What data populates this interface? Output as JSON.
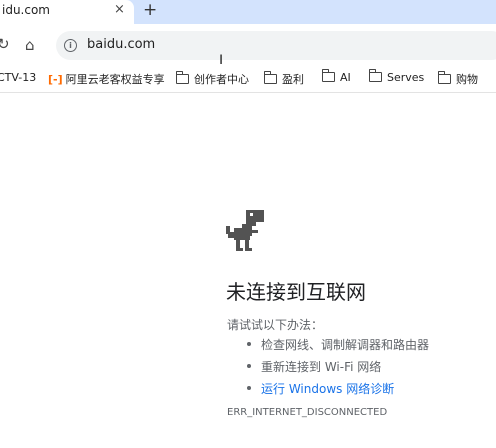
{
  "tab": {
    "title": "idu.com",
    "close": "×",
    "new_tab": "+"
  },
  "toolbar": {
    "reload": "↻",
    "home": "⌂",
    "info": "i",
    "url": "baidu.com",
    "cursor": "I"
  },
  "bookmarks": [
    {
      "label": "CTV-13",
      "icon": "none"
    },
    {
      "label": "阿里云老客权益专享",
      "icon": "aliyun-icon"
    },
    {
      "label": "创作者中心",
      "icon": "folder-icon"
    },
    {
      "label": "盈利",
      "icon": "folder-icon"
    },
    {
      "label": "AI",
      "icon": "folder-icon"
    },
    {
      "label": "Serves",
      "icon": "folder-icon"
    },
    {
      "label": "购物",
      "icon": "folder-icon"
    }
  ],
  "error": {
    "title": "未连接到互联网",
    "try_label": "请试试以下办法：",
    "suggestions": [
      {
        "text": "检查网线、调制解调器和路由器",
        "link": false
      },
      {
        "text": "重新连接到 Wi-Fi 网络",
        "link": false
      },
      {
        "text": "运行 Windows 网络诊断",
        "link": true
      }
    ],
    "code": "ERR_INTERNET_DISCONNECTED"
  },
  "colors": {
    "tabstrip": "#d3e3fd",
    "link": "#1a73e8",
    "text": "#202124",
    "secondary": "#5f6368",
    "aliyun": "#ff6a00"
  }
}
